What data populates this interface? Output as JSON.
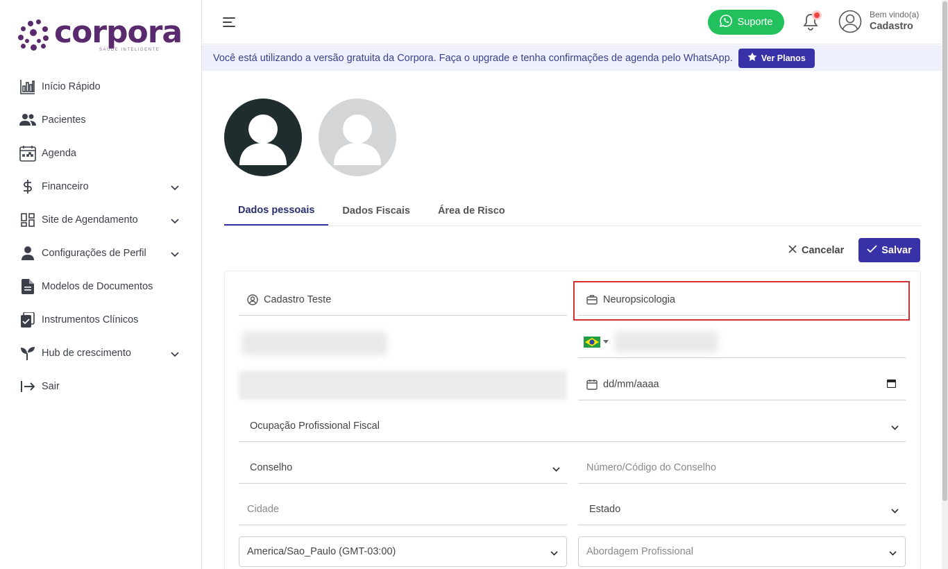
{
  "brand": {
    "name": "corpora",
    "tagline": "SAÚDE INTELIGENTE",
    "color": "#5a2a6e"
  },
  "sidebar": {
    "items": [
      {
        "label": "Início Rápido",
        "icon": "bar-chart-icon",
        "expandable": false
      },
      {
        "label": "Pacientes",
        "icon": "users-icon",
        "expandable": false
      },
      {
        "label": "Agenda",
        "icon": "calendar-icon",
        "expandable": false
      },
      {
        "label": "Financeiro",
        "icon": "dollar-icon",
        "expandable": true
      },
      {
        "label": "Site de Agendamento",
        "icon": "grid-icon",
        "expandable": true
      },
      {
        "label": "Configurações de Perfil",
        "icon": "person-icon",
        "expandable": true
      },
      {
        "label": "Modelos de Documentos",
        "icon": "document-icon",
        "expandable": false
      },
      {
        "label": "Instrumentos Clínicos",
        "icon": "clipboard-check-icon",
        "expandable": false
      },
      {
        "label": "Hub de crescimento",
        "icon": "sprout-icon",
        "expandable": true
      },
      {
        "label": "Sair",
        "icon": "logout-icon",
        "expandable": false
      }
    ]
  },
  "topbar": {
    "support_label": "Suporte",
    "welcome": "Bem vindo(a)",
    "username": "Cadastro",
    "support_color": "#22c15e"
  },
  "banner": {
    "text": "Você está utilizando a versão gratuita da Corpora. Faça o upgrade e tenha confirmações de agenda pelo WhatsApp.",
    "plans_label": "Ver Planos"
  },
  "tabs": [
    {
      "label": "Dados pessoais",
      "active": true
    },
    {
      "label": "Dados Fiscais",
      "active": false
    },
    {
      "label": "Área de Risco",
      "active": false
    }
  ],
  "actions": {
    "cancel_label": "Cancelar",
    "save_label": "Salvar",
    "accent": "#3931a8"
  },
  "form": {
    "name_value": "Cadastro Teste",
    "specialty_value": "Neuropsicologia",
    "birthdate_placeholder": "dd/mm/aaaa",
    "occupation_label": "Ocupação Profissional Fiscal",
    "council_label": "Conselho",
    "council_number_placeholder": "Número/Código do Conselho",
    "city_placeholder": "Cidade",
    "state_label": "Estado",
    "timezone_value": "America/Sao_Paulo (GMT-03:00)",
    "approach_placeholder": "Abordagem Profissional"
  }
}
